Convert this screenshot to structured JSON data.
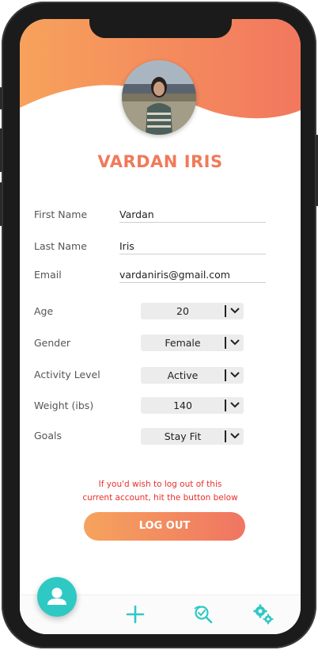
{
  "profile": {
    "name": "VARDAN IRIS"
  },
  "fields": {
    "first_name": {
      "label": "First Name",
      "value": "Vardan"
    },
    "last_name": {
      "label": "Last Name",
      "value": "Iris"
    },
    "email": {
      "label": "Email",
      "value": "vardaniris@gmail.com"
    }
  },
  "selects": {
    "age": {
      "label": "Age",
      "value": "20"
    },
    "gender": {
      "label": "Gender",
      "value": "Female"
    },
    "activity": {
      "label": "Activity Level",
      "value": "Active"
    },
    "weight": {
      "label": "Weight (ibs)",
      "value": "140"
    },
    "goals": {
      "label": "Goals",
      "value": "Stay Fit"
    }
  },
  "logout": {
    "notice_line1": "If you'd wish to log out of this",
    "notice_line2": "current account, hit the button below",
    "button_label": "LOG OUT"
  },
  "icons": {
    "profile_fab": "user-icon",
    "add": "plus-icon",
    "search": "search-check-icon",
    "settings": "gears-icon"
  },
  "colors": {
    "accent_orange": "#f07a5a",
    "accent_teal": "#2fc9c4",
    "notice_red": "#e8302a"
  }
}
